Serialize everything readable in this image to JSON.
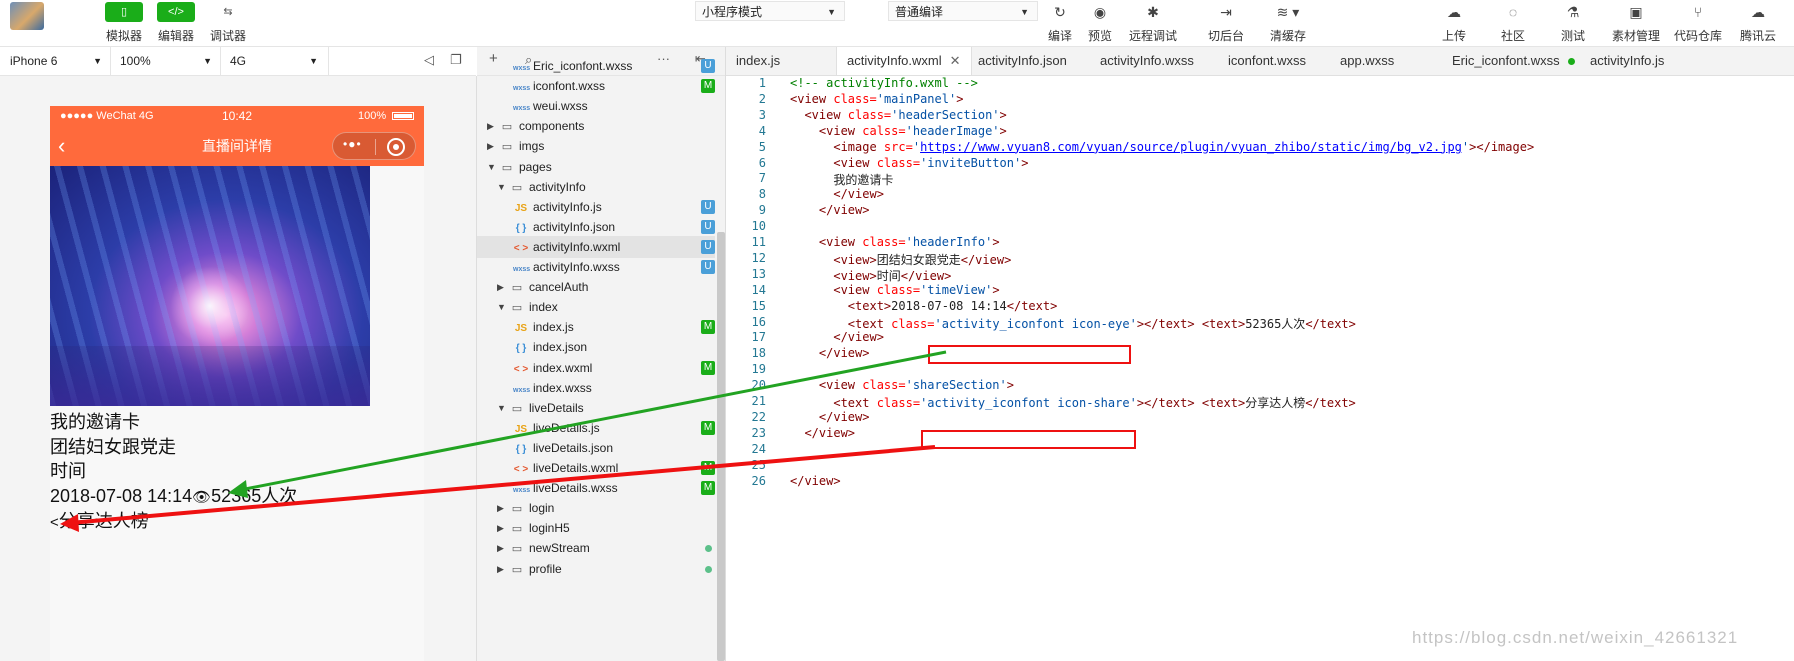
{
  "toolbar": {
    "left_buttons": [
      {
        "label": "模拟器",
        "icon": "phone-icon"
      },
      {
        "label": "编辑器",
        "icon": "code-icon"
      },
      {
        "label": "调试器",
        "icon": "debug-icon"
      }
    ],
    "mode_select": "小程序模式",
    "compile_select": "普通编译",
    "mid_buttons": [
      "编译",
      "预览",
      "远程调试",
      "切后台",
      "清缓存"
    ],
    "right_buttons": [
      "上传",
      "社区",
      "测试",
      "素材管理",
      "代码仓库",
      "腾讯云"
    ]
  },
  "simulator_bar": {
    "device": "iPhone 6",
    "zoom": "100%",
    "network": "4G"
  },
  "phone": {
    "status_left": "●●●●● WeChat 4G",
    "status_time": "10:42",
    "status_battery": "100%",
    "nav_title": "直播间详情",
    "lines": [
      "我的邀请卡",
      "团结妇女跟党走",
      "时间",
      "2018-07-08 14:14",
      "52365人次",
      "分享达人榜"
    ],
    "eye_glyph": "👁",
    "share_glyph": "<"
  },
  "filetree": {
    "rows": [
      {
        "name": "Eric_iconfont.wxss",
        "kind": "wxss",
        "depth": 2,
        "badge": "U"
      },
      {
        "name": "iconfont.wxss",
        "kind": "wxss",
        "depth": 2,
        "badge": "M"
      },
      {
        "name": "weui.wxss",
        "kind": "wxss",
        "depth": 2,
        "badge": ""
      },
      {
        "name": "components",
        "kind": "folder",
        "depth": 0,
        "caret": "right",
        "badge": ""
      },
      {
        "name": "imgs",
        "kind": "folder",
        "depth": 0,
        "caret": "right",
        "badge": ""
      },
      {
        "name": "pages",
        "kind": "folder",
        "depth": 0,
        "caret": "down",
        "badge": ""
      },
      {
        "name": "activityInfo",
        "kind": "folder",
        "depth": 1,
        "caret": "down",
        "badge": ""
      },
      {
        "name": "activityInfo.js",
        "kind": "js",
        "depth": 2,
        "badge": "U"
      },
      {
        "name": "activityInfo.json",
        "kind": "json",
        "depth": 2,
        "badge": "U"
      },
      {
        "name": "activityInfo.wxml",
        "kind": "wxml",
        "depth": 2,
        "badge": "U",
        "selected": true
      },
      {
        "name": "activityInfo.wxss",
        "kind": "wxss",
        "depth": 2,
        "badge": "U"
      },
      {
        "name": "cancelAuth",
        "kind": "folder",
        "depth": 1,
        "caret": "right",
        "badge": ""
      },
      {
        "name": "index",
        "kind": "folder",
        "depth": 1,
        "caret": "down",
        "badge": ""
      },
      {
        "name": "index.js",
        "kind": "js",
        "depth": 2,
        "badge": "M"
      },
      {
        "name": "index.json",
        "kind": "json",
        "depth": 2,
        "badge": ""
      },
      {
        "name": "index.wxml",
        "kind": "wxml",
        "depth": 2,
        "badge": "M"
      },
      {
        "name": "index.wxss",
        "kind": "wxss",
        "depth": 2,
        "badge": ""
      },
      {
        "name": "liveDetails",
        "kind": "folder",
        "depth": 1,
        "caret": "down",
        "badge": ""
      },
      {
        "name": "liveDetails.js",
        "kind": "js",
        "depth": 2,
        "badge": "M"
      },
      {
        "name": "liveDetails.json",
        "kind": "json",
        "depth": 2,
        "badge": ""
      },
      {
        "name": "liveDetails.wxml",
        "kind": "wxml",
        "depth": 2,
        "badge": "M"
      },
      {
        "name": "liveDetails.wxss",
        "kind": "wxss",
        "depth": 2,
        "badge": "M"
      },
      {
        "name": "login",
        "kind": "folder",
        "depth": 1,
        "caret": "right",
        "badge": ""
      },
      {
        "name": "loginH5",
        "kind": "folder",
        "depth": 1,
        "caret": "right",
        "badge": ""
      },
      {
        "name": "newStream",
        "kind": "folder",
        "depth": 1,
        "caret": "right",
        "badge": "dot"
      },
      {
        "name": "profile",
        "kind": "folder",
        "depth": 1,
        "caret": "right",
        "badge": "dot"
      }
    ],
    "icon_glyphs": {
      "wxss": "wxss",
      "js": "JS",
      "json": "{ }",
      "wxml": "< >",
      "folder": "▭"
    }
  },
  "editor": {
    "tabs": [
      {
        "label": "index.js"
      },
      {
        "label": "activityInfo.wxml",
        "active": true,
        "close": "✕"
      },
      {
        "label": "activityInfo.json"
      },
      {
        "label": "activityInfo.wxss"
      },
      {
        "label": "iconfont.wxss"
      },
      {
        "label": "app.wxss"
      },
      {
        "label": "Eric_iconfont.wxss",
        "modified": true
      },
      {
        "label": "activityInfo.js"
      }
    ],
    "lines": [
      [
        [
          "com",
          "<!-- activityInfo.wxml -->"
        ]
      ],
      [
        [
          "tag",
          "<view "
        ],
        [
          "attr",
          "class="
        ],
        [
          "str",
          "'mainPanel'"
        ],
        [
          "tag",
          ">"
        ]
      ],
      [
        [
          "tag",
          "  <view "
        ],
        [
          "attr",
          "class="
        ],
        [
          "str",
          "'headerSection'"
        ],
        [
          "tag",
          ">"
        ]
      ],
      [
        [
          "tag",
          "    <view "
        ],
        [
          "attr",
          "calss="
        ],
        [
          "str",
          "'headerImage'"
        ],
        [
          "tag",
          ">"
        ]
      ],
      [
        [
          "tag",
          "      <image "
        ],
        [
          "attr",
          "src="
        ],
        [
          "str",
          "'"
        ],
        [
          "url",
          "https://www.vyuan8.com/vyuan/source/plugin/vyuan_zhibo/static/img/bg_v2.jpg"
        ],
        [
          "str",
          "'"
        ],
        [
          "tag",
          "></image>"
        ]
      ],
      [
        [
          "tag",
          "      <view "
        ],
        [
          "attr",
          "class="
        ],
        [
          "str",
          "'inviteButton'"
        ],
        [
          "tag",
          ">"
        ]
      ],
      [
        [
          "txt",
          "      我的邀请卡"
        ]
      ],
      [
        [
          "tag",
          "      </view>"
        ]
      ],
      [
        [
          "tag",
          "    </view>"
        ]
      ],
      [
        [
          "txt",
          ""
        ]
      ],
      [
        [
          "tag",
          "    <view "
        ],
        [
          "attr",
          "class="
        ],
        [
          "str",
          "'headerInfo'"
        ],
        [
          "tag",
          ">"
        ]
      ],
      [
        [
          "tag",
          "      <view>"
        ],
        [
          "txt",
          "团结妇女跟党走"
        ],
        [
          "tag",
          "</view>"
        ]
      ],
      [
        [
          "tag",
          "      <view>"
        ],
        [
          "txt",
          "时间"
        ],
        [
          "tag",
          "</view>"
        ]
      ],
      [
        [
          "tag",
          "      <view "
        ],
        [
          "attr",
          "class="
        ],
        [
          "str",
          "'timeView'"
        ],
        [
          "tag",
          ">"
        ]
      ],
      [
        [
          "tag",
          "        <text>"
        ],
        [
          "txt",
          "2018-07-08 14:14"
        ],
        [
          "tag",
          "</text>"
        ]
      ],
      [
        [
          "tag",
          "        <text "
        ],
        [
          "attr",
          "class="
        ],
        [
          "str",
          "'activity_iconfont icon-eye'"
        ],
        [
          "tag",
          "></text> <text>"
        ],
        [
          "txt",
          "52365人次"
        ],
        [
          "tag",
          "</text>"
        ]
      ],
      [
        [
          "tag",
          "      </view>"
        ]
      ],
      [
        [
          "tag",
          "    </view>"
        ]
      ],
      [
        [
          "txt",
          ""
        ]
      ],
      [
        [
          "tag",
          "    <view "
        ],
        [
          "attr",
          "class="
        ],
        [
          "str",
          "'shareSection'"
        ],
        [
          "tag",
          ">"
        ]
      ],
      [
        [
          "tag",
          "      <text "
        ],
        [
          "attr",
          "class="
        ],
        [
          "str",
          "'activity_iconfont icon-share'"
        ],
        [
          "tag",
          "></text> <text>"
        ],
        [
          "txt",
          "分享达人榜"
        ],
        [
          "tag",
          "</text>"
        ]
      ],
      [
        [
          "tag",
          "    </view>"
        ]
      ],
      [
        [
          "tag",
          "  </view>"
        ]
      ],
      [
        [
          "txt",
          ""
        ]
      ],
      [
        [
          "txt",
          ""
        ]
      ],
      [
        [
          "tag",
          "</view>"
        ]
      ]
    ]
  },
  "watermark": "https://blog.csdn.net/weixin_42661321",
  "colors": {
    "wechat_green": "#1aad19",
    "nav_orange": "#ff6a3c",
    "annotation_red": "#ee1111",
    "annotation_green": "#22a322"
  }
}
